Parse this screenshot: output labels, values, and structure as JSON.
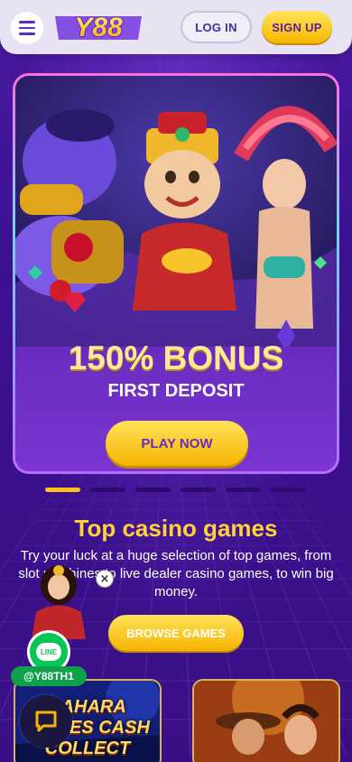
{
  "header": {
    "logo_text": "Y88",
    "login_label": "LOG IN",
    "signup_label": "SIGN UP"
  },
  "banner": {
    "headline": "150% BONUS",
    "subheadline": "FIRST DEPOSIT",
    "cta_label": "PLAY NOW"
  },
  "carousel": {
    "slide_count": 6,
    "active_index": 0
  },
  "section": {
    "title": "Top casino games",
    "description": "Try your luck at a huge selection of top games, from slot machines to live dealer casino games, to win big money.",
    "browse_label": "BROWSE GAMES"
  },
  "games": [
    {
      "name": "SAHARA RICHES CASH COLLECT"
    },
    {
      "name": "western-themed slot"
    }
  ],
  "widgets": {
    "line_label": "LINE",
    "line_handle": "@Y88TH1",
    "close_symbol": "×"
  },
  "colors": {
    "accent_yellow": "#f6b400",
    "brand_purple": "#3a0f86",
    "line_green": "#06c755"
  }
}
